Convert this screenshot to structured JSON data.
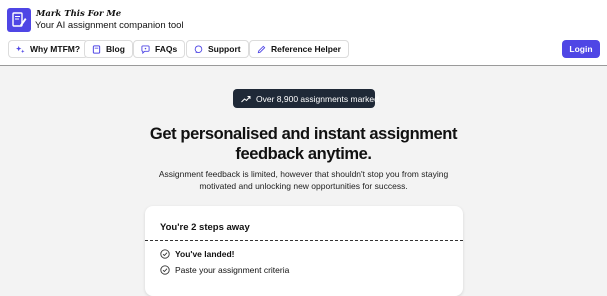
{
  "brand": {
    "name": "Mark This For Me",
    "tagline": "Your AI assignment companion tool",
    "accent": "#4f46e5"
  },
  "nav": {
    "items": [
      {
        "label": "Why MTFM?",
        "icon": "sparkle-icon"
      },
      {
        "label": "Blog",
        "icon": "book-icon"
      },
      {
        "label": "FAQs",
        "icon": "chat-question-icon"
      },
      {
        "label": "Support",
        "icon": "chat-bubble-icon"
      },
      {
        "label": "Reference Helper",
        "icon": "pencil-icon"
      }
    ],
    "login_label": "Login"
  },
  "hero": {
    "stat_badge": "Over 8,900 assignments marked",
    "stat_icon": "trending-up-icon",
    "headline_line1": "Get personalised and instant assignment",
    "headline_line2": "feedback anytime.",
    "subtext_line1": "Assignment feedback is limited, however that shouldn't stop you from staying",
    "subtext_line2": "motivated and unlocking new opportunities for success."
  },
  "steps_card": {
    "title": "You're 2 steps away",
    "steps": [
      {
        "label": "You've landed!",
        "icon": "check-circle-icon"
      },
      {
        "label": "Paste your assignment criteria",
        "icon": "check-circle-icon"
      }
    ]
  }
}
